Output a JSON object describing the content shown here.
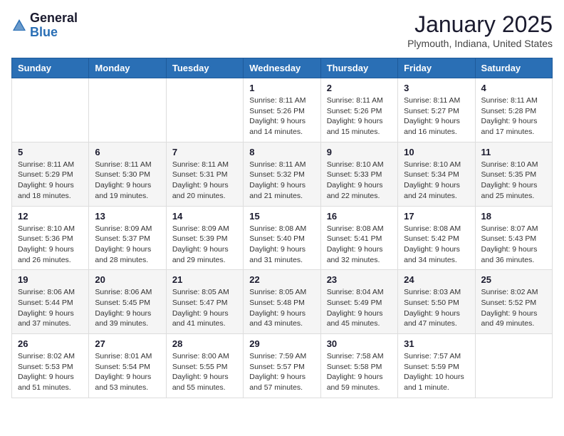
{
  "header": {
    "logo_general": "General",
    "logo_blue": "Blue",
    "month": "January 2025",
    "location": "Plymouth, Indiana, United States"
  },
  "weekdays": [
    "Sunday",
    "Monday",
    "Tuesday",
    "Wednesday",
    "Thursday",
    "Friday",
    "Saturday"
  ],
  "weeks": [
    [
      {
        "day": "",
        "info": ""
      },
      {
        "day": "",
        "info": ""
      },
      {
        "day": "",
        "info": ""
      },
      {
        "day": "1",
        "info": "Sunrise: 8:11 AM\nSunset: 5:26 PM\nDaylight: 9 hours\nand 14 minutes."
      },
      {
        "day": "2",
        "info": "Sunrise: 8:11 AM\nSunset: 5:26 PM\nDaylight: 9 hours\nand 15 minutes."
      },
      {
        "day": "3",
        "info": "Sunrise: 8:11 AM\nSunset: 5:27 PM\nDaylight: 9 hours\nand 16 minutes."
      },
      {
        "day": "4",
        "info": "Sunrise: 8:11 AM\nSunset: 5:28 PM\nDaylight: 9 hours\nand 17 minutes."
      }
    ],
    [
      {
        "day": "5",
        "info": "Sunrise: 8:11 AM\nSunset: 5:29 PM\nDaylight: 9 hours\nand 18 minutes."
      },
      {
        "day": "6",
        "info": "Sunrise: 8:11 AM\nSunset: 5:30 PM\nDaylight: 9 hours\nand 19 minutes."
      },
      {
        "day": "7",
        "info": "Sunrise: 8:11 AM\nSunset: 5:31 PM\nDaylight: 9 hours\nand 20 minutes."
      },
      {
        "day": "8",
        "info": "Sunrise: 8:11 AM\nSunset: 5:32 PM\nDaylight: 9 hours\nand 21 minutes."
      },
      {
        "day": "9",
        "info": "Sunrise: 8:10 AM\nSunset: 5:33 PM\nDaylight: 9 hours\nand 22 minutes."
      },
      {
        "day": "10",
        "info": "Sunrise: 8:10 AM\nSunset: 5:34 PM\nDaylight: 9 hours\nand 24 minutes."
      },
      {
        "day": "11",
        "info": "Sunrise: 8:10 AM\nSunset: 5:35 PM\nDaylight: 9 hours\nand 25 minutes."
      }
    ],
    [
      {
        "day": "12",
        "info": "Sunrise: 8:10 AM\nSunset: 5:36 PM\nDaylight: 9 hours\nand 26 minutes."
      },
      {
        "day": "13",
        "info": "Sunrise: 8:09 AM\nSunset: 5:37 PM\nDaylight: 9 hours\nand 28 minutes."
      },
      {
        "day": "14",
        "info": "Sunrise: 8:09 AM\nSunset: 5:39 PM\nDaylight: 9 hours\nand 29 minutes."
      },
      {
        "day": "15",
        "info": "Sunrise: 8:08 AM\nSunset: 5:40 PM\nDaylight: 9 hours\nand 31 minutes."
      },
      {
        "day": "16",
        "info": "Sunrise: 8:08 AM\nSunset: 5:41 PM\nDaylight: 9 hours\nand 32 minutes."
      },
      {
        "day": "17",
        "info": "Sunrise: 8:08 AM\nSunset: 5:42 PM\nDaylight: 9 hours\nand 34 minutes."
      },
      {
        "day": "18",
        "info": "Sunrise: 8:07 AM\nSunset: 5:43 PM\nDaylight: 9 hours\nand 36 minutes."
      }
    ],
    [
      {
        "day": "19",
        "info": "Sunrise: 8:06 AM\nSunset: 5:44 PM\nDaylight: 9 hours\nand 37 minutes."
      },
      {
        "day": "20",
        "info": "Sunrise: 8:06 AM\nSunset: 5:45 PM\nDaylight: 9 hours\nand 39 minutes."
      },
      {
        "day": "21",
        "info": "Sunrise: 8:05 AM\nSunset: 5:47 PM\nDaylight: 9 hours\nand 41 minutes."
      },
      {
        "day": "22",
        "info": "Sunrise: 8:05 AM\nSunset: 5:48 PM\nDaylight: 9 hours\nand 43 minutes."
      },
      {
        "day": "23",
        "info": "Sunrise: 8:04 AM\nSunset: 5:49 PM\nDaylight: 9 hours\nand 45 minutes."
      },
      {
        "day": "24",
        "info": "Sunrise: 8:03 AM\nSunset: 5:50 PM\nDaylight: 9 hours\nand 47 minutes."
      },
      {
        "day": "25",
        "info": "Sunrise: 8:02 AM\nSunset: 5:52 PM\nDaylight: 9 hours\nand 49 minutes."
      }
    ],
    [
      {
        "day": "26",
        "info": "Sunrise: 8:02 AM\nSunset: 5:53 PM\nDaylight: 9 hours\nand 51 minutes."
      },
      {
        "day": "27",
        "info": "Sunrise: 8:01 AM\nSunset: 5:54 PM\nDaylight: 9 hours\nand 53 minutes."
      },
      {
        "day": "28",
        "info": "Sunrise: 8:00 AM\nSunset: 5:55 PM\nDaylight: 9 hours\nand 55 minutes."
      },
      {
        "day": "29",
        "info": "Sunrise: 7:59 AM\nSunset: 5:57 PM\nDaylight: 9 hours\nand 57 minutes."
      },
      {
        "day": "30",
        "info": "Sunrise: 7:58 AM\nSunset: 5:58 PM\nDaylight: 9 hours\nand 59 minutes."
      },
      {
        "day": "31",
        "info": "Sunrise: 7:57 AM\nSunset: 5:59 PM\nDaylight: 10 hours\nand 1 minute."
      },
      {
        "day": "",
        "info": ""
      }
    ]
  ]
}
